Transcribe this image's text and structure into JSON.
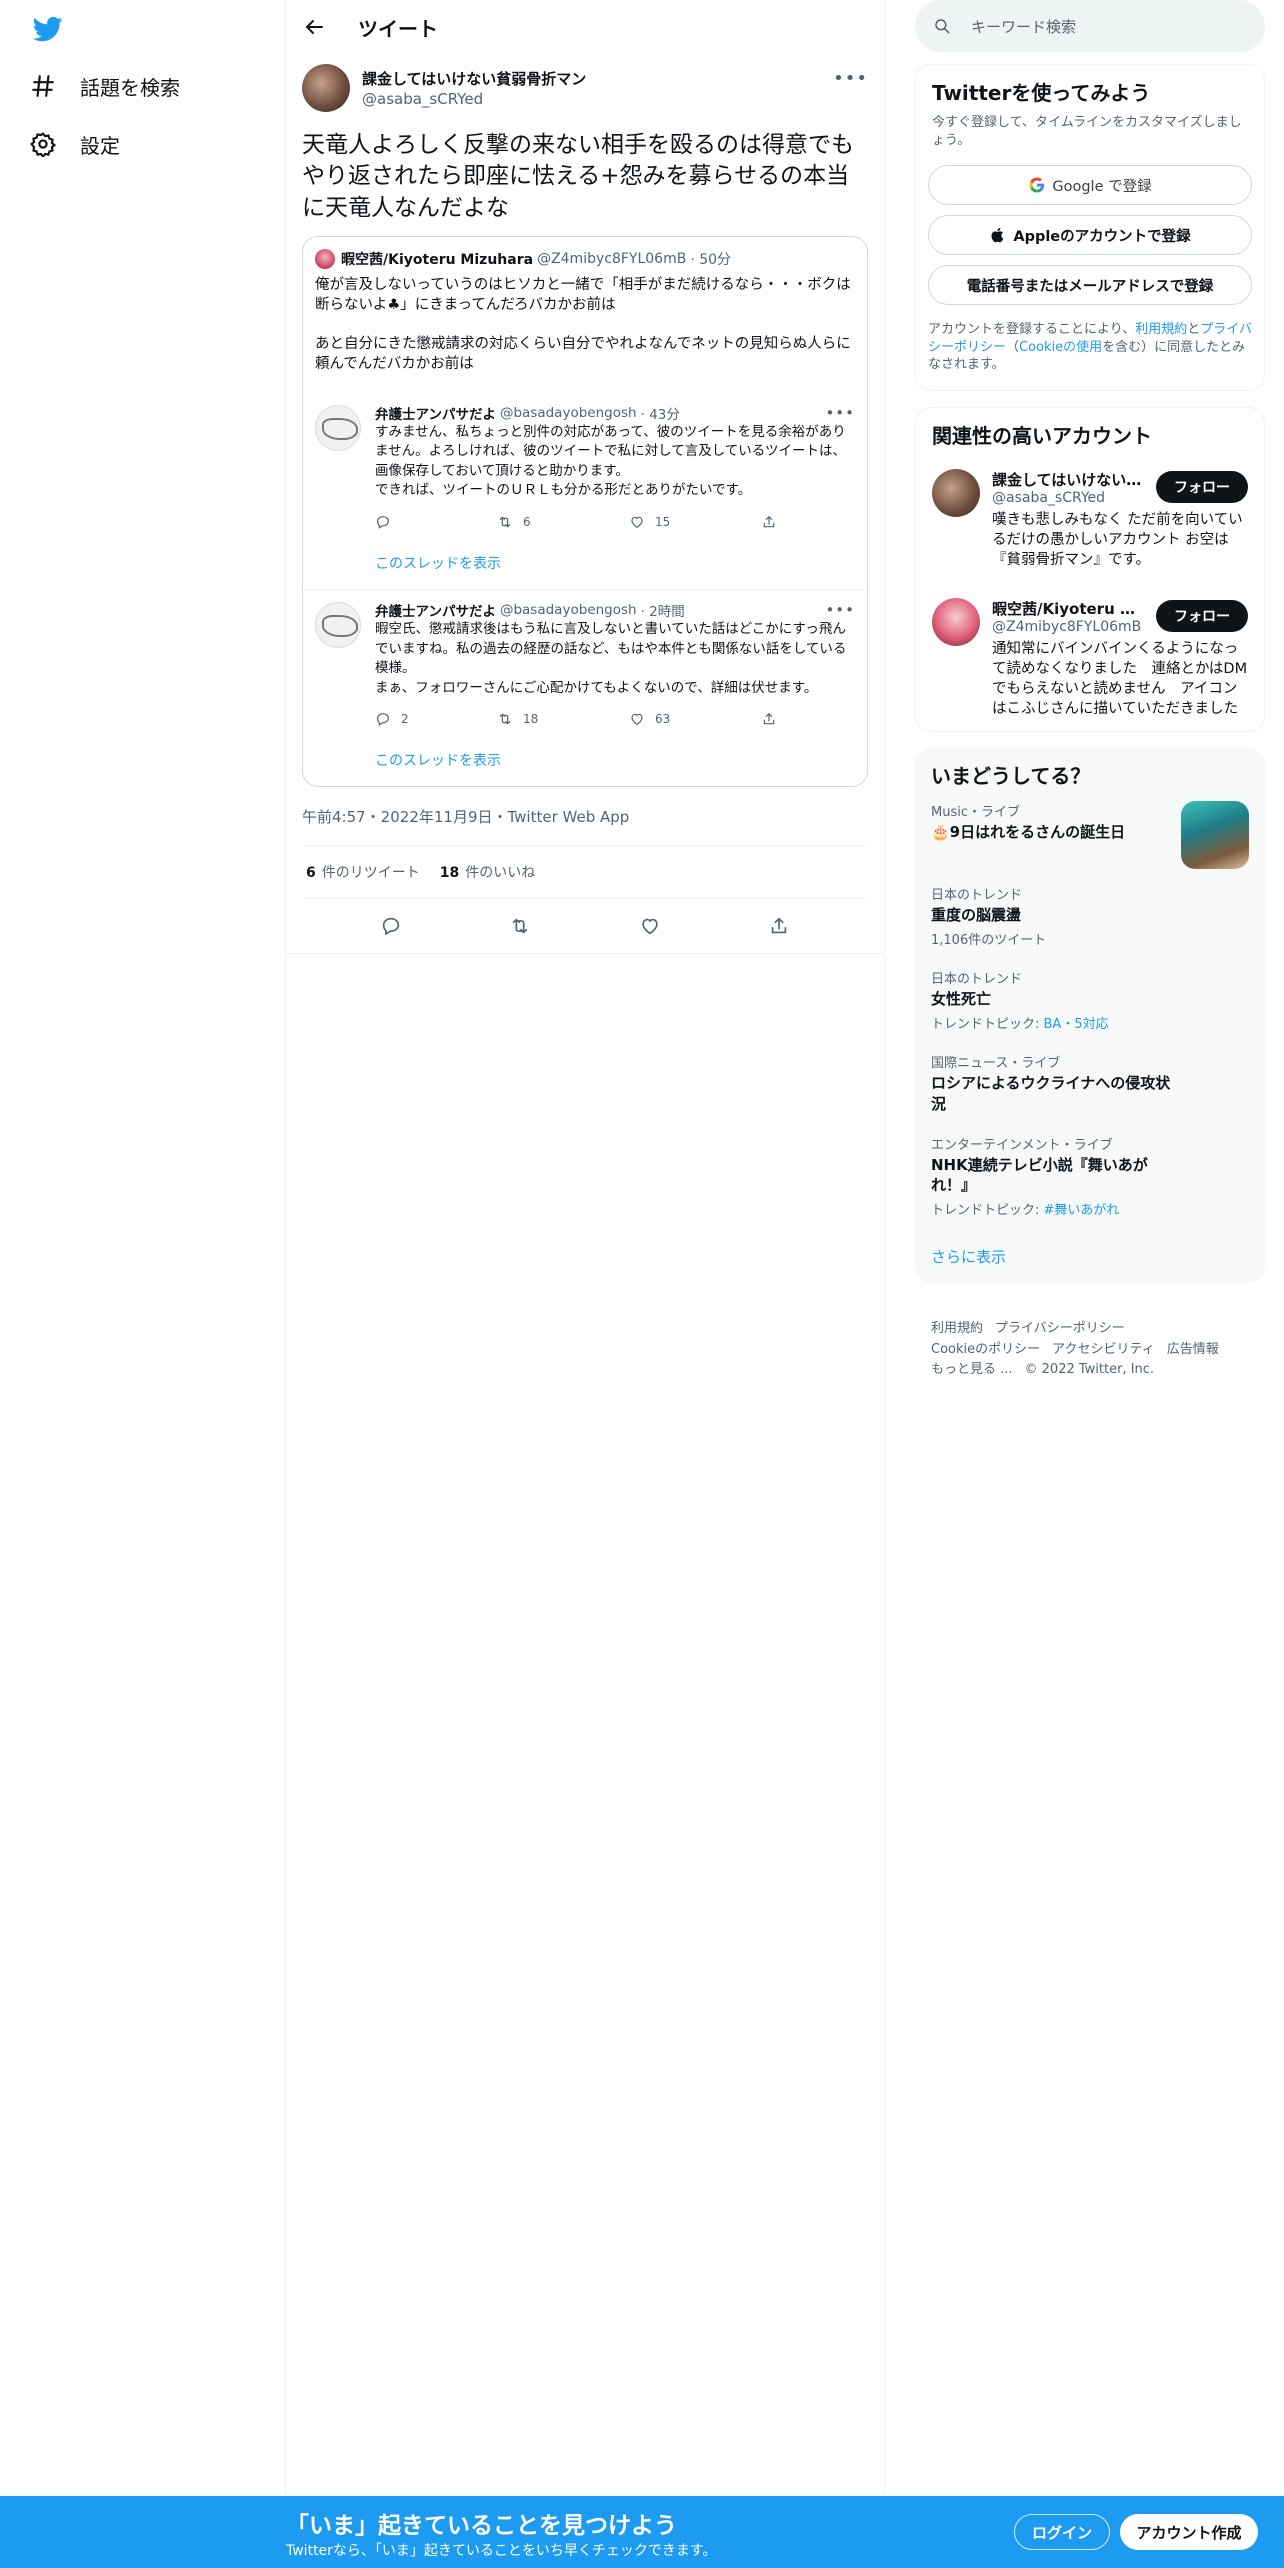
{
  "nav": {
    "explore_label": "話題を検索",
    "settings_label": "設定"
  },
  "header": {
    "title": "ツイート"
  },
  "tweet": {
    "author_name": "課金してはいけない貧弱骨折マン",
    "author_handle": "@asaba_sCRYed",
    "text": "天竜人よろしく反撃の来ない相手を殴るのは得意でもやり返されたら即座に怯える+怨みを募らせるの本当に天竜人なんだよな",
    "timestamp": "午前4:57・2022年11月9日・Twitter Web App",
    "retweets_count": "6",
    "retweets_label": "件のリツイート",
    "likes_count": "18",
    "likes_label": "件のいいね"
  },
  "quote": {
    "author_name": "暇空茜/Kiyoteru Mizuhara",
    "author_handle": "@Z4mibyc8FYL06mB",
    "time": "· 50分",
    "paragraph1": "俺が言及しないっていうのはヒソカと一緒で「相手がまだ続けるなら・・・ボクは断らないよ♣」にきまってんだろバカかお前は",
    "paragraph2": "あと自分にきた懲戒請求の対応くらい自分でやれよなんでネットの見知らぬ人らに頼んでんだバカかお前は"
  },
  "replies": [
    {
      "name": "弁護士アンパサだよ",
      "handle": "@basadayobengosh",
      "time": "· 43分",
      "text": "すみません、私ちょっと別件の対応があって、彼のツイートを見る余裕がありません。よろしければ、彼のツイートで私に対して言及しているツイートは、画像保存しておいて頂けると助かります。\nできれば、ツイートのＵＲＬも分かる形だとありがたいです。",
      "replies": "",
      "retweets": "6",
      "likes": "15",
      "show_thread": "このスレッドを表示"
    },
    {
      "name": "弁護士アンパサだよ",
      "handle": "@basadayobengosh",
      "time": "· 2時間",
      "text": "暇空氏、懲戒請求後はもう私に言及しないと書いていた話はどこかにすっ飛んでいますね。私の過去の経歴の話など、もはや本件とも関係ない話をしている模様。\nまぁ、フォロワーさんにご心配かけてもよくないので、詳細は伏せます。",
      "replies": "2",
      "retweets": "18",
      "likes": "63",
      "show_thread": "このスレッドを表示"
    }
  ],
  "search": {
    "placeholder": "キーワード検索"
  },
  "signup_card": {
    "title": "Twitterを使ってみよう",
    "subtitle": "今すぐ登録して、タイムラインをカスタマイズしましょう。",
    "google_label": "Google で登録",
    "apple_label": "Appleのアカウントで登録",
    "phone_label": "電話番号またはメールアドレスで登録",
    "terms_prefix": "アカウントを登録することにより、",
    "terms_link": "利用規約",
    "terms_and": "と",
    "privacy_link": "プライバシーポリシー",
    "cookie_open": "（",
    "cookie_link": "Cookieの使用",
    "cookie_suffix": "を含む）に同意したとみなされます。"
  },
  "related": {
    "title": "関連性の高いアカウント",
    "follow_label": "フォロー",
    "accounts": [
      {
        "name": "課金してはいけない貧弱骨折マン",
        "handle": "@asaba_sCRYed",
        "bio": "嘆きも悲しみもなく ただ前を向いているだけの愚かしいアカウント お空は『貧弱骨折マン』です。"
      },
      {
        "name": "暇空茜/Kiyoteru Mizuhara",
        "handle": "@Z4mibyc8FYL06mB",
        "bio": "通知常にバインバインくるようになって読めなくなりました　連絡とかはDMでもらえないと読めません　アイコンはこふじさんに描いていただきました"
      }
    ]
  },
  "trends": {
    "title": "いまどうしてる？",
    "items": [
      {
        "category": "Music・ライブ",
        "title": "🎂9日はれをるさんの誕生日",
        "sub": "",
        "sub_link": ""
      },
      {
        "category": "日本のトレンド",
        "title": "重度の脳震盪",
        "sub": "1,106件のツイート",
        "sub_link": ""
      },
      {
        "category": "日本のトレンド",
        "title": "女性死亡",
        "sub": "トレンドトピック: ",
        "sub_link": "BA・5対応"
      },
      {
        "category": "国際ニュース・ライブ",
        "title": "ロシアによるウクライナへの侵攻状況",
        "sub": "",
        "sub_link": ""
      },
      {
        "category": "エンターテインメント・ライブ",
        "title": "NHK連続テレビ小説『舞いあがれ！』",
        "sub": "トレンドトピック: ",
        "sub_link": "#舞いあがれ"
      }
    ],
    "show_more": "さらに表示"
  },
  "footer": {
    "terms": "利用規約",
    "privacy": "プライバシーポリシー",
    "cookie": "Cookieのポリシー",
    "accessibility": "アクセシビリティ",
    "ads": "広告情報",
    "more": "もっと見る ...",
    "copyright": "© 2022 Twitter, Inc."
  },
  "banner": {
    "title": "「いま」起きていることを見つけよう",
    "subtitle": "Twitterなら、「いま」起きていることをいち早くチェックできます。",
    "login_label": "ログイン",
    "signup_label": "アカウント作成"
  },
  "colors": {
    "accent": "#1d9bf0",
    "text": "#0f1419",
    "muted": "#536471",
    "border": "#eff3f4"
  },
  "icons": [
    "twitter-logo-icon",
    "hashtag-icon",
    "gear-icon",
    "back-arrow-icon",
    "search-icon",
    "reply-icon",
    "retweet-icon",
    "like-icon",
    "share-icon",
    "google-icon",
    "apple-icon"
  ]
}
